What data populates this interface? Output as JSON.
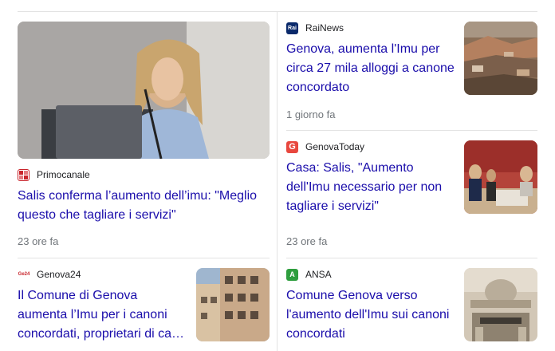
{
  "colors": {
    "link": "#1a0dab",
    "meta": "#70757a",
    "divider": "#e3e3e3"
  },
  "articles": [
    {
      "source": "Primocanale",
      "favicon_icon": "primocanale-logo-icon",
      "favicon_color": "#c8242b",
      "headline": "Salis conferma l’aumento dell’imu: \"Meglio questo che tagliare i servizi\"",
      "time": "23 ore fa"
    },
    {
      "source": "RaiNews",
      "favicon_icon": "rainews-logo-icon",
      "favicon_text": "Rai",
      "favicon_color": "#0a2a6b",
      "headline": "Genova, aumenta l'Imu per circa 27 mila alloggi a canone concordato",
      "time": "1 giorno fa"
    },
    {
      "source": "GenovaToday",
      "favicon_icon": "genovatoday-logo-icon",
      "favicon_text": "G",
      "favicon_color": "#e8473e",
      "headline": "Casa: Salis, \"Aumento dell'Imu necessario per non tagliare i servizi\"",
      "time": "23 ore fa"
    },
    {
      "source": "Genova24",
      "favicon_icon": "genova24-logo-icon",
      "favicon_text": "Ge24",
      "favicon_color": "#ffffff",
      "headline": "Il Comune di Genova aumenta l’Imu per i canoni concordati, proprietari di ca…",
      "time": ""
    },
    {
      "source": "ANSA",
      "favicon_icon": "ansa-logo-icon",
      "favicon_text": "A",
      "favicon_color": "#2e9e3e",
      "headline": "Comune Genova verso l'aumento dell'Imu sui canoni concordati",
      "time": ""
    }
  ]
}
